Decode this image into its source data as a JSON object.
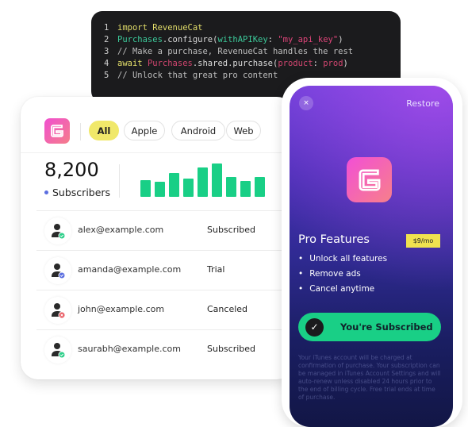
{
  "code": {
    "lines": [
      {
        "n": "1",
        "parts": [
          [
            "kw",
            "import "
          ],
          [
            "kw",
            "RevenueCat"
          ]
        ]
      },
      {
        "n": "2",
        "parts": [
          [
            "ty",
            "Purchases"
          ],
          [
            "",
            "."
          ],
          [
            "",
            "configure("
          ],
          [
            "ty",
            "withAPIKey"
          ],
          [
            "",
            ": "
          ],
          [
            "st",
            "\"my_api_key\""
          ],
          [
            "",
            ")"
          ]
        ]
      },
      {
        "n": "3",
        "parts": [
          [
            "cm",
            "// Make a purchase, RevenueCat handles the rest"
          ]
        ]
      },
      {
        "n": "4",
        "parts": [
          [
            "kw",
            "await "
          ],
          [
            "pk",
            "Purchases"
          ],
          [
            "",
            ".shared.purchase("
          ],
          [
            "pk",
            "product"
          ],
          [
            "",
            ": "
          ],
          [
            "pk",
            "prod"
          ],
          [
            "",
            ")"
          ]
        ]
      },
      {
        "n": "5",
        "parts": [
          [
            "cm",
            "// Unlock that great pro content"
          ]
        ]
      }
    ]
  },
  "dashboard": {
    "filters": [
      {
        "label": "All",
        "active": true
      },
      {
        "label": "Apple"
      },
      {
        "label": "Android"
      },
      {
        "label": "Web"
      }
    ],
    "count": "8,200",
    "count_label": "Subscribers",
    "chart_data": {
      "type": "bar",
      "values": [
        63,
        57,
        92,
        70,
        112,
        127,
        77,
        60,
        77
      ],
      "color": "#19cf86"
    },
    "rows": [
      {
        "email": "alex@example.com",
        "status": "Subscribed",
        "badge": "check",
        "badge_color": "#2ecf8a"
      },
      {
        "email": "amanda@example.com",
        "status": "Trial",
        "badge": "check",
        "badge_color": "#5b6ee0"
      },
      {
        "email": "john@example.com",
        "status": "Canceled",
        "badge": "x",
        "badge_color": "#e8525a"
      },
      {
        "email": "saurabh@example.com",
        "status": "Subscribed",
        "badge": "check",
        "badge_color": "#2ecf8a"
      }
    ]
  },
  "paywall": {
    "close": "×",
    "restore": "Restore",
    "title": "Pro Features",
    "price": "$9/mo",
    "features": [
      "Unlock all features",
      "Remove ads",
      "Cancel anytime"
    ],
    "button": "You're Subscribed",
    "legal": "Your iTunes account will be charged at confirmation of purchase. Your subscription can be managed in iTunes Account Settings and will auto-renew unless disabled 24 hours prior to the end of billing cycle. Free trial ends at time of purchase."
  }
}
